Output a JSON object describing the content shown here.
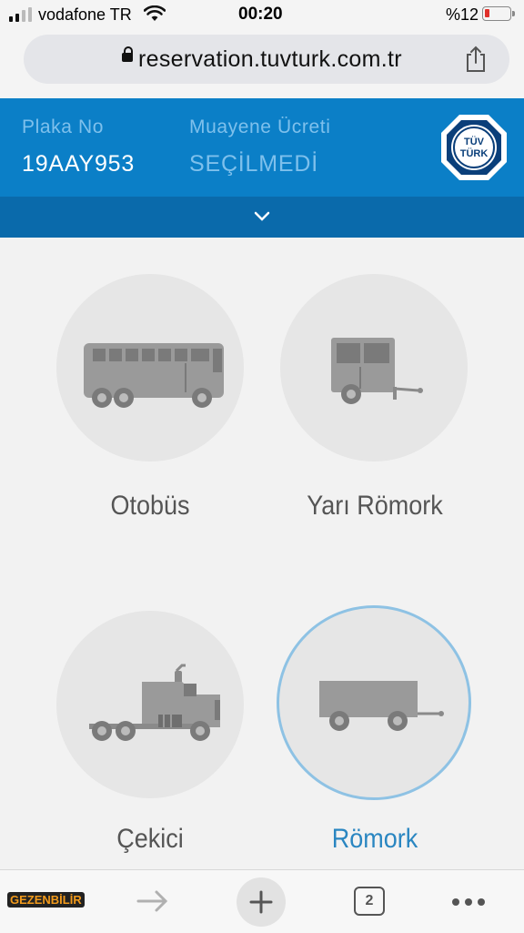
{
  "status_bar": {
    "carrier": "vodafone TR",
    "time": "00:20",
    "battery": "%12"
  },
  "browser": {
    "url": "reservation.tuvturk.com.tr"
  },
  "header": {
    "plate_label": "Plaka No",
    "plate_value": "19AAY953",
    "fee_label": "Muayene Ücreti",
    "fee_value": "SEÇİLMEDİ",
    "logo_text_top": "TÜV",
    "logo_text_bottom": "TÜRK",
    "colors": {
      "bar": "#0b7fc7",
      "collapse": "#0a6aab",
      "accent": "#7ec0ec"
    }
  },
  "vehicle_types": [
    {
      "label": "Otobüs",
      "icon": "bus-icon",
      "selected": false
    },
    {
      "label": "Yarı Römork",
      "icon": "semi-trailer-icon",
      "selected": false
    },
    {
      "label": "Çekici",
      "icon": "tractor-truck-icon",
      "selected": false
    },
    {
      "label": "Römork",
      "icon": "trailer-icon",
      "selected": true
    }
  ],
  "toolbar": {
    "tabs_count": "2",
    "watermark": "GEZENBİLİR"
  }
}
